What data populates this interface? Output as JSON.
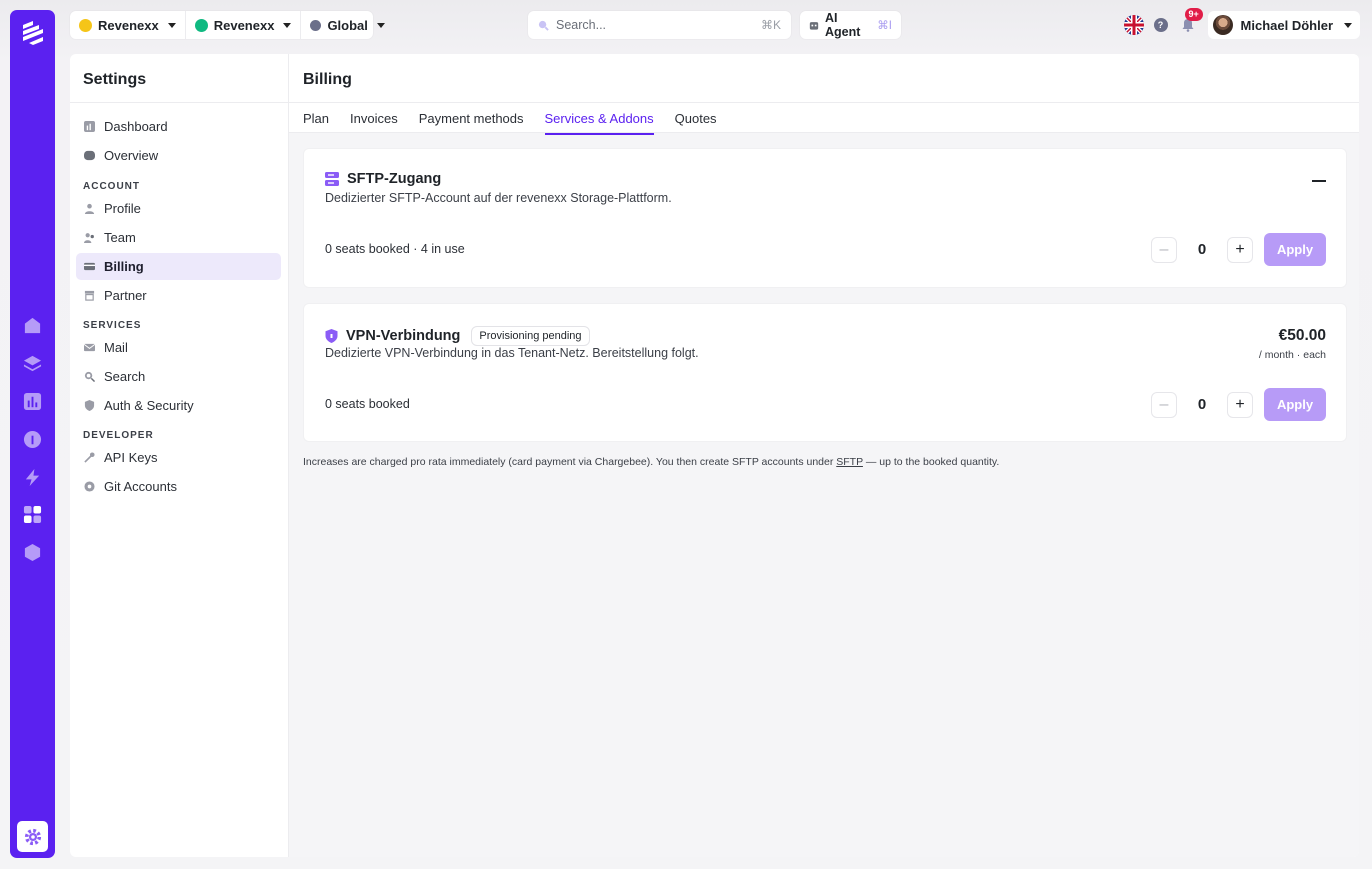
{
  "topbar": {
    "workspaces": [
      {
        "label": "Revenexx",
        "color": "#f5c518"
      },
      {
        "label": "Revenexx",
        "color": "#10b981"
      },
      {
        "label": "Global",
        "color": "#6b6f8a"
      }
    ],
    "search_placeholder": "Search...",
    "search_shortcut": "⌘K",
    "agent_label": "AI Agent",
    "agent_shortcut": "⌘I",
    "help_label": "?",
    "notifications_badge": "9+",
    "user_name": "Michael Döhler"
  },
  "sidebar": {
    "title": "Settings",
    "items_top": [
      {
        "label": "Dashboard",
        "icon": "chart-icon"
      },
      {
        "label": "Overview",
        "icon": "overview-icon"
      }
    ],
    "sections": [
      {
        "label": "ACCOUNT",
        "items": [
          {
            "label": "Profile",
            "icon": "user-icon"
          },
          {
            "label": "Team",
            "icon": "team-icon"
          },
          {
            "label": "Billing",
            "icon": "card-icon",
            "active": true
          },
          {
            "label": "Partner",
            "icon": "store-icon"
          }
        ]
      },
      {
        "label": "SERVICES",
        "items": [
          {
            "label": "Mail",
            "icon": "mail-icon"
          },
          {
            "label": "Search",
            "icon": "search-icon"
          },
          {
            "label": "Auth & Security",
            "icon": "shield-icon"
          }
        ]
      },
      {
        "label": "DEVELOPER",
        "items": [
          {
            "label": "API Keys",
            "icon": "key-icon"
          },
          {
            "label": "Git Accounts",
            "icon": "git-icon"
          }
        ]
      }
    ]
  },
  "page": {
    "title": "Billing",
    "tabs": [
      {
        "label": "Plan"
      },
      {
        "label": "Invoices"
      },
      {
        "label": "Payment methods"
      },
      {
        "label": "Services & Addons",
        "active": true
      },
      {
        "label": "Quotes"
      }
    ]
  },
  "services": [
    {
      "title": "SFTP-Zugang",
      "description": "Dedizierter SFTP-Account auf der revenexx Storage-Plattform.",
      "seats_text": "0 seats booked · 4 in use",
      "quantity": "0",
      "apply_label": "Apply"
    },
    {
      "title": "VPN-Verbindung",
      "badge": "Provisioning pending",
      "description": "Dedizierte VPN-Verbindung in das Tenant-Netz. Bereitstellung folgt.",
      "price": "€50.00",
      "price_unit": "/ month · each",
      "seats_text": "0 seats booked",
      "quantity": "0",
      "apply_label": "Apply"
    }
  ],
  "footer_note": {
    "before": "Increases are charged pro rata immediately (card payment via Chargebee). You then create SFTP accounts under ",
    "link": "SFTP",
    "after": " — up to the booked quantity."
  },
  "colors": {
    "accent": "#5b21f0",
    "apply_disabled": "#b79bf7",
    "badge_red": "#e11d48"
  }
}
